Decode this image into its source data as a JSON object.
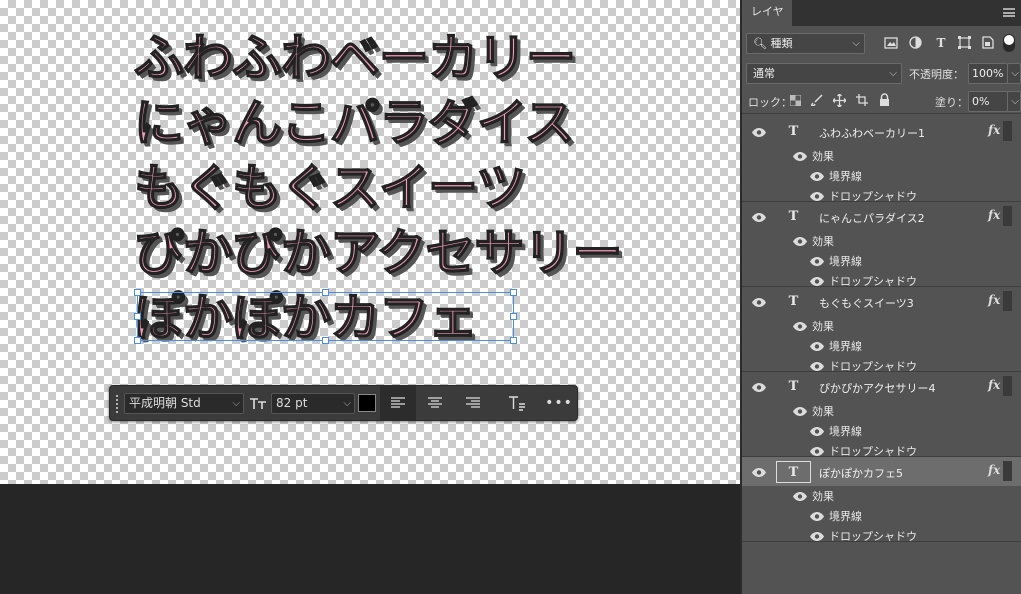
{
  "canvas": {
    "lines": [
      "ふわふわベーカリー",
      "にゃんこパラダイス",
      "もぐもぐスイーツ",
      "ぴかぴかアクセサリー",
      "ぽかぽかカフェ"
    ]
  },
  "taskbar": {
    "font_family": "平成明朝 Std",
    "font_size": "82 pt",
    "color": "#000000",
    "icons": [
      "grip-handle",
      "text-size-icon",
      "align-left-icon",
      "align-center-icon",
      "align-right-icon",
      "text-options-icon",
      "more-icon"
    ]
  },
  "panel": {
    "tab_label": "レイヤー",
    "filter": {
      "icon": "search-icon",
      "value": "種類"
    },
    "blend_mode": "通常",
    "opacity_label": "不透明度：",
    "opacity_value": "100%",
    "lock_label": "ロック：",
    "fill_label": "塗り：",
    "fill_value": "0%",
    "layers": [
      {
        "name": "ふわふわベーカリー1",
        "effects_label": "効果",
        "effects": [
          "境界線",
          "ドロップシャドウ"
        ],
        "selected": false
      },
      {
        "name": "にゃんこパラダイス2",
        "effects_label": "効果",
        "effects": [
          "境界線",
          "ドロップシャドウ"
        ],
        "selected": false
      },
      {
        "name": "もぐもぐスイーツ3",
        "effects_label": "効果",
        "effects": [
          "境界線",
          "ドロップシャドウ"
        ],
        "selected": false
      },
      {
        "name": "ぴかぴかアクセサリー4",
        "effects_label": "効果",
        "effects": [
          "境界線",
          "ドロップシャドウ"
        ],
        "selected": false
      },
      {
        "name": "ぽかぽかカフェ5",
        "effects_label": "効果",
        "effects": [
          "境界線",
          "ドロップシャドウ"
        ],
        "selected": true
      }
    ],
    "fx_label": "fx",
    "layer_type_glyph": "T"
  },
  "colors": {
    "text_fill": "#f39ab9",
    "selection": "#4a8fe0",
    "panel_bg": "#535353"
  }
}
